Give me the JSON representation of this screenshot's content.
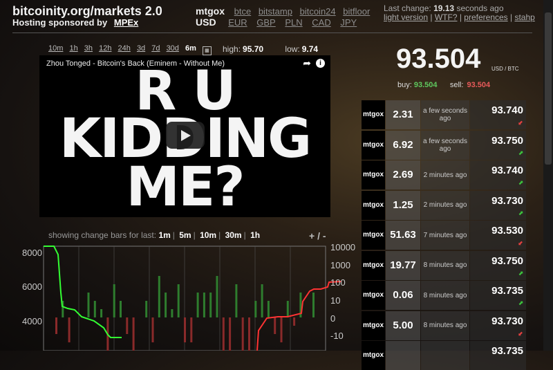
{
  "header": {
    "title": "bitcoinity.org/markets 2.0",
    "sponsor_label": "Hosting sponsored by",
    "sponsor_name": "MPEx"
  },
  "exchanges": {
    "active": "mtgox",
    "others": [
      "btce",
      "bitstamp",
      "bitcoin24",
      "bitfloor"
    ]
  },
  "currencies": {
    "active": "USD",
    "others": [
      "EUR",
      "GBP",
      "PLN",
      "CAD",
      "JPY"
    ]
  },
  "status": {
    "last_change_label": "Last change:",
    "last_change_value": "19.13",
    "last_change_suffix": "seconds ago"
  },
  "nav_links": [
    "light version",
    "WTF?",
    "preferences",
    "stahp"
  ],
  "ranges": [
    "10m",
    "1h",
    "3h",
    "12h",
    "24h",
    "3d",
    "7d",
    "30d",
    "6m"
  ],
  "ranges_selected": "6m",
  "stats": {
    "high_label": "high:",
    "high": "95.70",
    "low_label": "low:",
    "low": "9.74"
  },
  "video": {
    "title": "Zhou Tonged - Bitcoin's Back (Eminem - Without Me)",
    "line1": "R U",
    "line2": "KIDDING",
    "line3": "ME?"
  },
  "change_bars": {
    "label": "showing change bars for last:",
    "options": [
      "1m",
      "5m",
      "10m",
      "30m",
      "1h"
    ],
    "plus": "+",
    "minus": "-"
  },
  "price": {
    "value": "93.504",
    "unit": "USD / BTC",
    "buy_label": "buy:",
    "buy": "93.504",
    "sell_label": "sell:",
    "sell": "93.504"
  },
  "trades": [
    {
      "exchange": "mtgox",
      "amount": "2.31",
      "time": "a few seconds ago",
      "price": "93.740",
      "dir": "down"
    },
    {
      "exchange": "mtgox",
      "amount": "6.92",
      "time": "a few seconds ago",
      "price": "93.750",
      "dir": "up"
    },
    {
      "exchange": "mtgox",
      "amount": "2.69",
      "time": "2 minutes ago",
      "price": "93.740",
      "dir": "up"
    },
    {
      "exchange": "mtgox",
      "amount": "1.25",
      "time": "2 minutes ago",
      "price": "93.730",
      "dir": "up"
    },
    {
      "exchange": "mtgox",
      "amount": "51.63",
      "time": "7 minutes ago",
      "price": "93.530",
      "dir": "down"
    },
    {
      "exchange": "mtgox",
      "amount": "19.77",
      "time": "8 minutes ago",
      "price": "93.750",
      "dir": "up"
    },
    {
      "exchange": "mtgox",
      "amount": "0.06",
      "time": "8 minutes ago",
      "price": "93.735",
      "dir": "up"
    },
    {
      "exchange": "mtgox",
      "amount": "5.00",
      "time": "8 minutes ago",
      "price": "93.730",
      "dir": "down"
    },
    {
      "exchange": "mtgox",
      "amount": "",
      "time": "",
      "price": "93.735",
      "dir": ""
    }
  ],
  "colors": {
    "up": "#3cc43c",
    "down": "#e34040",
    "depth_bid": "#33ff33",
    "depth_ask": "#ff3333"
  },
  "chart_data": {
    "type": "bar",
    "left_axis": {
      "ticks": [
        8000,
        6000,
        4000
      ]
    },
    "right_axis": {
      "ticks": [
        "10000",
        "1000",
        "100",
        "10",
        "0",
        "-10"
      ]
    },
    "bars": [
      -2,
      2,
      -3,
      0,
      0,
      3,
      2,
      1,
      -4,
      4,
      2,
      -2,
      -4,
      0,
      2,
      -3,
      5,
      3,
      1,
      4,
      -3,
      -3,
      3,
      3,
      3,
      5,
      -4,
      -4,
      4,
      -4,
      -4,
      2,
      4,
      2,
      -2,
      -3,
      2,
      -1,
      3,
      0,
      3
    ]
  }
}
